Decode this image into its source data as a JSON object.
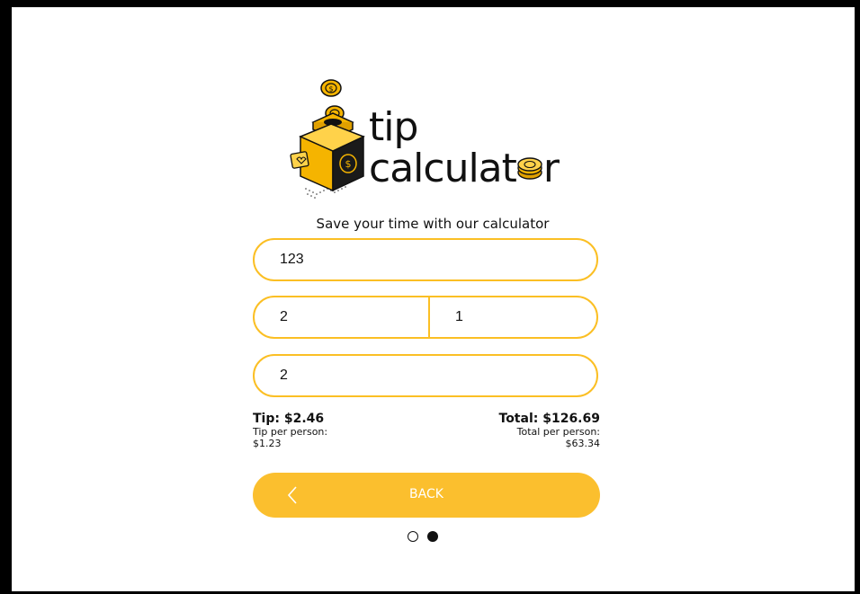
{
  "logo": {
    "line1": "tip",
    "line2_prefix": "calculat",
    "line2_suffix": "r",
    "icon": "jar-with-coins-icon",
    "coin_icon": "coin-icon"
  },
  "subtitle": "Save your time with our calculator",
  "fields": {
    "bill": {
      "value": "123"
    },
    "tip_percent": {
      "value": "2"
    },
    "tip_extra": {
      "value": "1"
    },
    "people": {
      "value": "2"
    }
  },
  "results": {
    "tip_label": "Tip: $2.46",
    "tip_per_person_label": "Tip per person:",
    "tip_per_person_value": "$1.23",
    "total_label": "Total: $126.69",
    "total_per_person_label": "Total per person:",
    "total_per_person_value": "$63.34"
  },
  "back_button": {
    "label": "BACK",
    "icon": "chevron-left-icon"
  },
  "pagination": {
    "current": 2,
    "total": 2
  },
  "colors": {
    "accent": "#fbbf24",
    "text": "#111111",
    "background": "#ffffff",
    "frame": "#000000"
  }
}
